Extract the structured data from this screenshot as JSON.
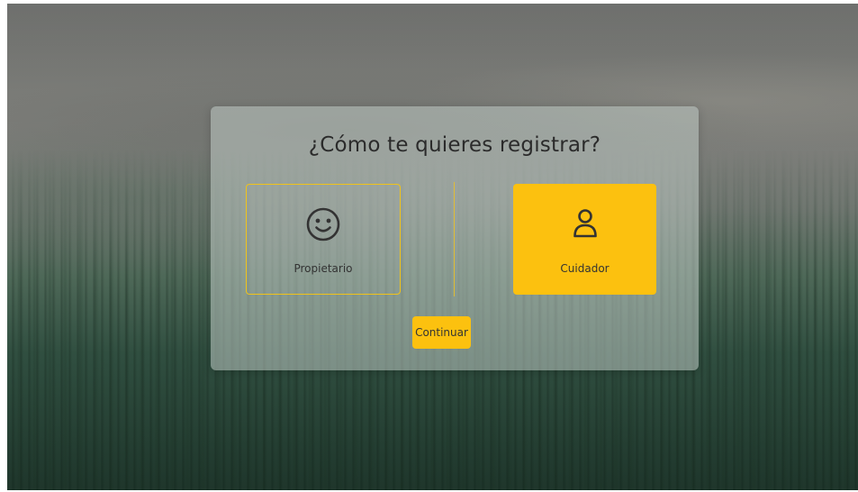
{
  "dialog": {
    "title": "¿Cómo te quieres registrar?",
    "options": [
      {
        "label": "Propietario",
        "icon": "smiley-face-icon",
        "selected": false
      },
      {
        "label": "Cuidador",
        "icon": "person-icon",
        "selected": true
      }
    ],
    "continue_label": "Continuar"
  },
  "colors": {
    "accent": "#fcc10f",
    "outline": "#f0c31a",
    "text": "#333333"
  }
}
